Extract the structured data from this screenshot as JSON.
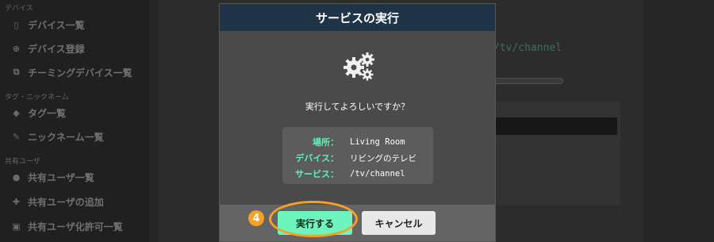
{
  "sidebar": {
    "sections": [
      {
        "label": "デバイス"
      },
      {
        "label": "タグ・ニックネーム"
      },
      {
        "label": "共有ユーザ"
      }
    ],
    "items": [
      {
        "label": "デバイス一覧",
        "icon": "device-icon"
      },
      {
        "label": "デバイス登録",
        "icon": "plus-circle-icon"
      },
      {
        "label": "チーミングデバイス一覧",
        "icon": "teaming-icon"
      },
      {
        "label": "タグ一覧",
        "icon": "tag-icon"
      },
      {
        "label": "ニックネーム一覧",
        "icon": "pencil-icon"
      },
      {
        "label": "共有ユーザ一覧",
        "icon": "user-icon"
      },
      {
        "label": "共有ユーザの追加",
        "icon": "user-plus-icon"
      },
      {
        "label": "共有ユーザ化許可一覧",
        "icon": "lock-icon"
      }
    ]
  },
  "background": {
    "path": "/tv/channel"
  },
  "modal": {
    "title": "サービスの実行",
    "icon": "gears-icon",
    "confirm_text": "実行してよろしいですか？",
    "info": [
      {
        "label": "場所：",
        "value": "Living Room"
      },
      {
        "label": "デバイス：",
        "value": "リビングのテレビ"
      },
      {
        "label": "サービス：",
        "value": "/tv/channel"
      }
    ],
    "run_label": "実行する",
    "cancel_label": "キャンセル"
  },
  "annotation": {
    "step": "4",
    "color": "#f6a123"
  },
  "colors": {
    "header": "#1f3547",
    "accent": "#62f0b6",
    "run_button": "#6cf6bd"
  }
}
